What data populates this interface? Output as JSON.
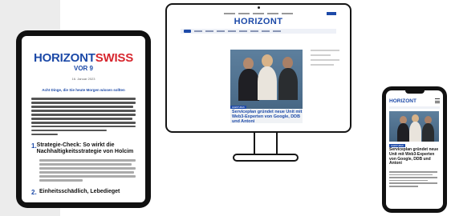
{
  "tablet": {
    "brand_part1": "HORIZONT",
    "brand_part2": "SWISS",
    "edition": "VOR 9",
    "date": "16. Januar 2023",
    "headline": "Acht Dinge, die Sie heute Morgen wissen sollten",
    "intro_lines": [
      100,
      100,
      98,
      100,
      100,
      97,
      100,
      100,
      72,
      25
    ],
    "section1_number": "1.",
    "section1_title": "Strategie-Check: So wirkt die Nachhaltigkeitsstrategie von Holcim",
    "section1_body_lines": [
      100,
      96,
      100,
      98,
      100,
      45
    ],
    "section2_number": "2.",
    "section2_title": "Einheitsschädlich, Lebedieget"
  },
  "monitor": {
    "logo": "HORIZONT",
    "category": "AGENTUREN",
    "headline": "Servicepłan gründet neue Unit mit Web3-Experten von Google, DDB und Antoni",
    "colors": {
      "brand_blue": "#1d4aa8",
      "brand_red": "#d7262e"
    }
  },
  "phone": {
    "logo": "HORIZONT",
    "category": "AGENTUREN",
    "headline": "Serviceplan gründet neue Unit mit Web3-Experten von Google, DDB und Antoni"
  }
}
